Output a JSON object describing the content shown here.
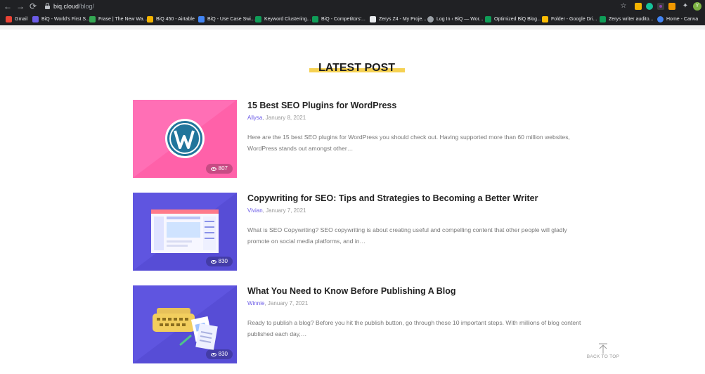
{
  "browser": {
    "url_host": "biq.cloud",
    "url_path": "/blog/",
    "avatar_letter": "Y",
    "bookmarks": [
      {
        "label": "Gmail",
        "color": "#ea4335"
      },
      {
        "label": "BiQ - World's First S...",
        "color": "#6c5ce7"
      },
      {
        "label": "Frase | The New Wa...",
        "color": "#34a853"
      },
      {
        "label": "BiQ 450 - Airtable",
        "color": "#f4b400"
      },
      {
        "label": "BiQ - Use Case Swi...",
        "color": "#4285f4"
      },
      {
        "label": "Keyword Clustering...",
        "color": "#0f9d58"
      },
      {
        "label": "BiQ - Competitors'...",
        "color": "#0f9d58"
      },
      {
        "label": "Zerys Z4 - My Proje...",
        "color": "#e8eaed"
      },
      {
        "label": "Log In ‹ BiQ — Wor...",
        "color": "#9aa0a6"
      },
      {
        "label": "Optimized BiQ Blog...",
        "color": "#0f9d58"
      },
      {
        "label": "Folder - Google Dri...",
        "color": "#fbbc04"
      },
      {
        "label": "Zerys writer audito...",
        "color": "#0f9d58"
      },
      {
        "label": "Home - Canva",
        "color": "#4285f4"
      }
    ]
  },
  "section": {
    "title": "LATEST POST"
  },
  "posts": [
    {
      "title": "15 Best SEO Plugins for WordPress",
      "author": "Allysa",
      "date": ", January 8, 2021",
      "excerpt": "Here are the 15 best SEO plugins for WordPress you should check out.  Having supported more than 60 million websites, WordPress stands out amongst other…",
      "views": "807"
    },
    {
      "title": "Copywriting for SEO: Tips and Strategies to Becoming a Better Writer",
      "author": "Vivian",
      "date": ", January 7, 2021",
      "excerpt": "What is SEO Copywriting? SEO copywriting is about creating useful and compelling content that other people will gladly promote on social media platforms, and in…",
      "views": "830"
    },
    {
      "title": "What You Need to Know Before Publishing A Blog",
      "author": "Winnie",
      "date": ", January 7, 2021",
      "excerpt": "Ready to publish a blog? Before you hit the publish button, go through these 10 important steps. With millions of blog content published each day,…",
      "views": "830"
    }
  ],
  "back_to_top": {
    "label": "BACK TO TOP"
  }
}
